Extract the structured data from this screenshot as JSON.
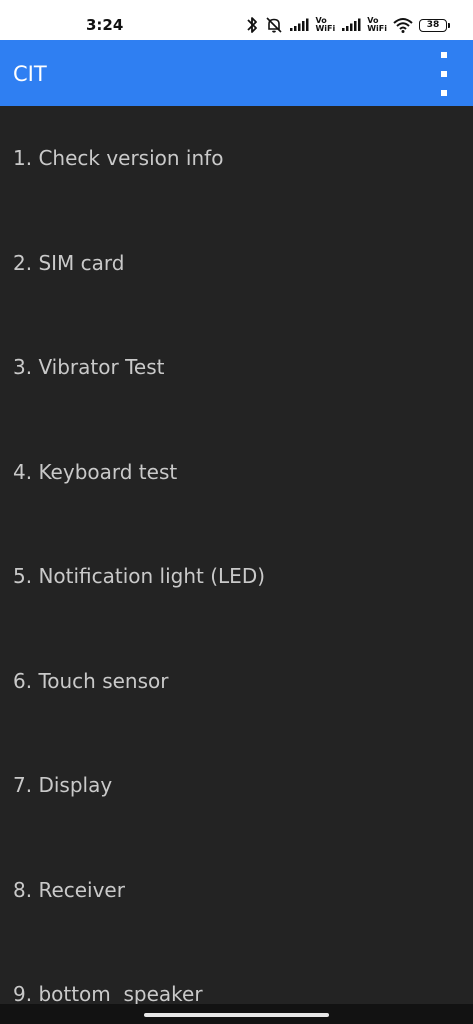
{
  "status_bar": {
    "time": "3:24",
    "battery_level": "38",
    "volte_1": {
      "top": "Vo",
      "bottom": "WiFi"
    },
    "volte_2": {
      "top": "Vo",
      "bottom": "WiFi"
    },
    "icons": [
      "bluetooth-icon",
      "bell-off-icon",
      "signal-icon",
      "signal-icon",
      "wifi-icon",
      "battery-icon"
    ]
  },
  "app_bar": {
    "title": "CIT",
    "menu_icon": "more-vert-icon"
  },
  "colors": {
    "app_bar": "#2f7ff2",
    "background": "#232323",
    "item_text": "#c9c9c9"
  },
  "items": [
    {
      "label": "1. Check version info"
    },
    {
      "label": "2. SIM card"
    },
    {
      "label": "3. Vibrator Test"
    },
    {
      "label": "4. Keyboard test"
    },
    {
      "label": "5. Notification light (LED)"
    },
    {
      "label": "6. Touch sensor"
    },
    {
      "label": "7. Display"
    },
    {
      "label": "8. Receiver"
    },
    {
      "label": "9. bottom  speaker"
    }
  ]
}
